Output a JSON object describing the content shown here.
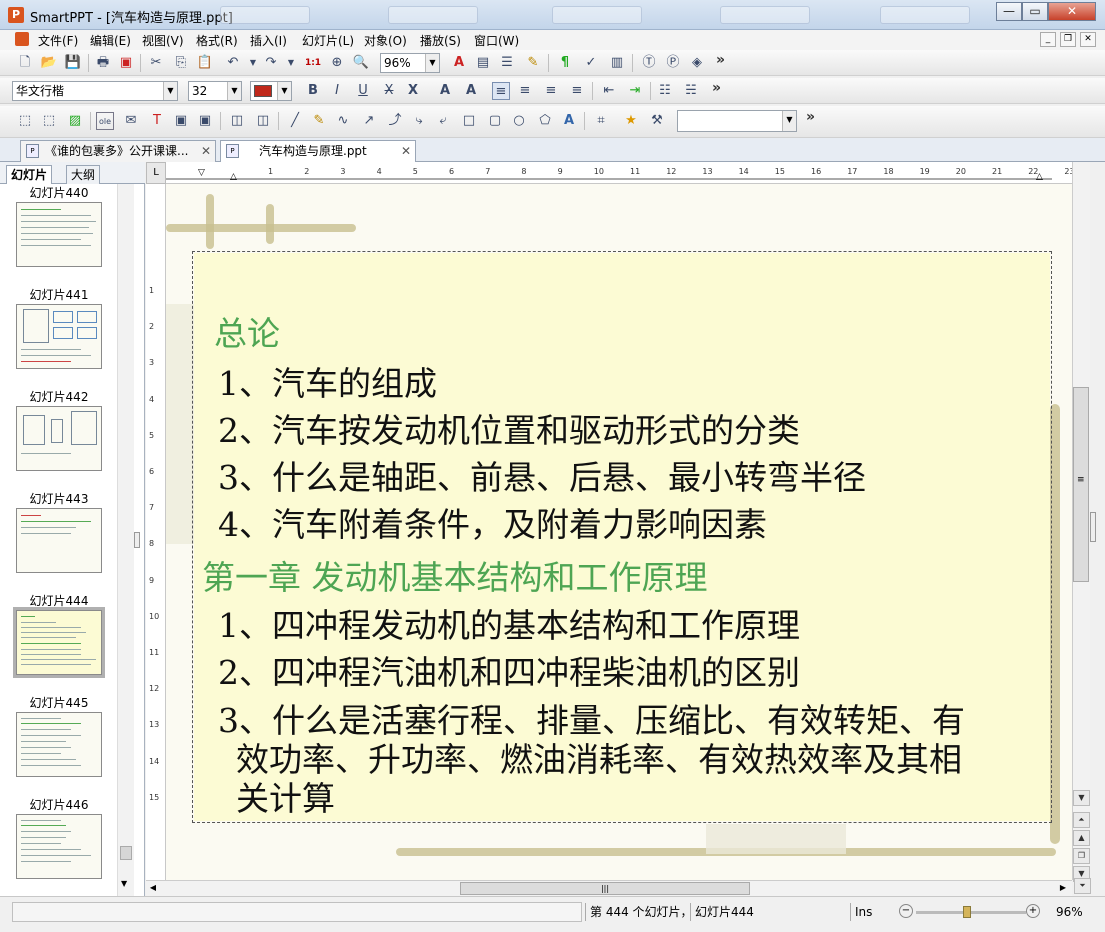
{
  "window": {
    "title": "SmartPPT - [汽车构造与原理.ppt]",
    "app_icon": "P"
  },
  "menu": [
    "文件(F)",
    "编辑(E)",
    "视图(V)",
    "格式(R)",
    "插入(I)",
    "幻灯片(L)",
    "对象(O)",
    "播放(S)",
    "窗口(W)"
  ],
  "toolbar1": {
    "zoom_value": "96%"
  },
  "toolbar2": {
    "font_name": "华文行楷",
    "font_size": "32",
    "font_color": "#c0281b"
  },
  "doc_tabs": [
    {
      "label": "《谁的包裹多》公开课课...",
      "active": false
    },
    {
      "label": "汽车构造与原理.ppt",
      "active": true
    }
  ],
  "panel_tabs": {
    "slides": "幻灯片",
    "outline": "大纲"
  },
  "thumbnails": [
    {
      "label": "幻灯片440"
    },
    {
      "label": "幻灯片441"
    },
    {
      "label": "幻灯片442"
    },
    {
      "label": "幻灯片443"
    },
    {
      "label": "幻灯片444",
      "selected": true
    },
    {
      "label": "幻灯片445"
    },
    {
      "label": "幻灯片446"
    }
  ],
  "ruler": {
    "h_numbers": [
      "1",
      "2",
      "3",
      "4",
      "5",
      "6",
      "7",
      "8",
      "9",
      "10",
      "11",
      "12",
      "13",
      "14",
      "15",
      "16",
      "17",
      "18",
      "19",
      "20",
      "21",
      "22",
      "23"
    ],
    "v_numbers": [
      "1",
      "2",
      "3",
      "4",
      "5",
      "6",
      "7",
      "8",
      "9",
      "10",
      "11",
      "12",
      "13",
      "14",
      "15"
    ]
  },
  "slide": {
    "lines": [
      {
        "text": "总论",
        "color": "green"
      },
      {
        "text": "1、汽车的组成"
      },
      {
        "text": "2、汽车按发动机位置和驱动形式的分类"
      },
      {
        "text": "3、什么是轴距、前悬、后悬、最小转弯半径"
      },
      {
        "text": "4、汽车附着条件，及附着力影响因素"
      },
      {
        "text": "第一章 发动机基本结构和工作原理",
        "color": "green"
      },
      {
        "text": "1、四冲程发动机的基本结构和工作原理"
      },
      {
        "text": "2、四冲程汽油机和四冲程柴油机的区别"
      },
      {
        "text": "3、什么是活塞行程、排量、压缩比、有效转矩、有"
      },
      {
        "text": "效功率、升功率、燃油消耗率、有效热效率及其相"
      },
      {
        "text": "关计算"
      }
    ]
  },
  "status": {
    "slide_pos": "第 444 个幻灯片，",
    "slide_name": "幻灯片444",
    "mode": "Ins",
    "zoom": "96%"
  },
  "colors": {
    "green_text": "#4ea553",
    "text_fill": "#fcfbd4"
  }
}
